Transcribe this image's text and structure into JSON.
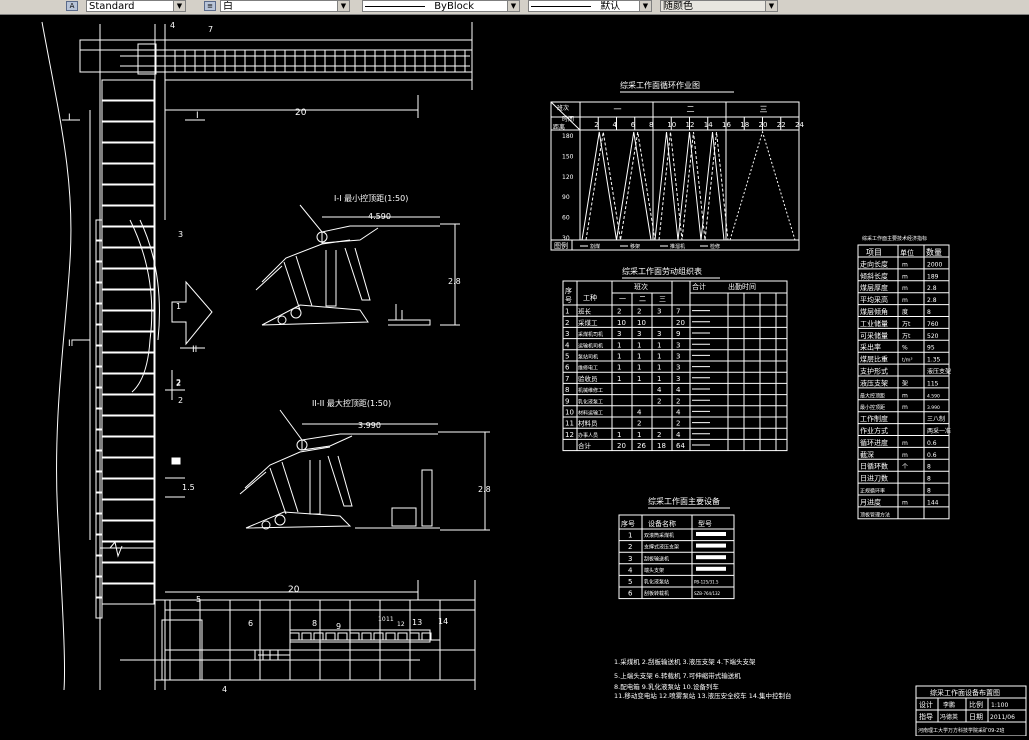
{
  "toolbar": {
    "text_style": "Standard",
    "layer": "白",
    "linetype": "ByBlock",
    "lineweight": "默认",
    "plot_style": "随颜色"
  },
  "drawing": {
    "dim_top_20": "20",
    "dim_bottom_20": "20",
    "section_I": "I",
    "section_II": "II",
    "callouts": [
      "1",
      "2",
      "3",
      "4",
      "5",
      "6",
      "7",
      "8",
      "9",
      "10",
      "11",
      "12",
      "13",
      "14"
    ],
    "dim_2": "2",
    "dim_1_5": "1.5",
    "dim_4": "4",
    "min_section_title": "I-I  最小控顶距(1:50)",
    "min_section_width": "4.590",
    "min_section_height": "2.8",
    "max_section_title": "II-II 最大控顶距(1:50)",
    "max_section_width": "3.990",
    "max_section_height": "2.8"
  },
  "cycle_chart": {
    "title": "综采工作面循环作业图",
    "corner_top": "班次",
    "corner_mid": "时间",
    "corner_bot": "距离",
    "shifts": [
      "一",
      "二",
      "三"
    ],
    "hours": [
      "2",
      "4",
      "6",
      "8",
      "10",
      "12",
      "14",
      "16",
      "18",
      "20",
      "22",
      "24"
    ],
    "distances": [
      "180",
      "150",
      "120",
      "90",
      "60",
      "30"
    ],
    "legend_label": "图例",
    "legend_items": [
      "割煤",
      "移架",
      "推溜机",
      "检修"
    ]
  },
  "labor_table": {
    "title": "综采工作面劳动组织表",
    "h_no": "序号",
    "h_type": "工种",
    "h_shift": "班次",
    "h_total": "合计",
    "h_time": "出勤时间",
    "shift_cols": [
      "一",
      "二",
      "三"
    ],
    "rows": [
      {
        "n": "1",
        "t": "班长",
        "a": "2",
        "b": "2",
        "c": "3",
        "s": "7"
      },
      {
        "n": "2",
        "t": "采煤工",
        "a": "10",
        "b": "10",
        "c": "",
        "s": "20"
      },
      {
        "n": "3",
        "t": "采煤机司机",
        "a": "3",
        "b": "3",
        "c": "3",
        "s": "9"
      },
      {
        "n": "4",
        "t": "运输机司机",
        "a": "1",
        "b": "1",
        "c": "1",
        "s": "3"
      },
      {
        "n": "5",
        "t": "泵站司机",
        "a": "1",
        "b": "1",
        "c": "1",
        "s": "3"
      },
      {
        "n": "6",
        "t": "维修电工",
        "a": "1",
        "b": "1",
        "c": "1",
        "s": "3"
      },
      {
        "n": "7",
        "t": "验收员",
        "a": "1",
        "b": "1",
        "c": "1",
        "s": "3"
      },
      {
        "n": "8",
        "t": "机械维修工",
        "a": "",
        "b": "",
        "c": "4",
        "s": "4"
      },
      {
        "n": "9",
        "t": "乳化液泵工",
        "a": "",
        "b": "",
        "c": "2",
        "s": "2"
      },
      {
        "n": "10",
        "t": "材料运输工",
        "a": "",
        "b": "4",
        "c": "",
        "s": "4"
      },
      {
        "n": "11",
        "t": "材料员",
        "a": "",
        "b": "2",
        "c": "",
        "s": "2"
      },
      {
        "n": "12",
        "t": "办事人员",
        "a": "1",
        "b": "1",
        "c": "2",
        "s": "4"
      },
      {
        "n": "",
        "t": "合计",
        "a": "20",
        "b": "26",
        "c": "18",
        "s": "64"
      }
    ]
  },
  "equipment_table": {
    "title": "综采工作面主要设备",
    "h_no": "序号",
    "h_name": "设备名称",
    "h_model": "型号",
    "rows": [
      {
        "n": "1",
        "name": "双滚筒采煤机",
        "model": ""
      },
      {
        "n": "2",
        "name": "支撑式液压支架",
        "model": ""
      },
      {
        "n": "3",
        "name": "刮板输送机",
        "model": ""
      },
      {
        "n": "4",
        "name": "端头支架",
        "model": ""
      },
      {
        "n": "5",
        "name": "乳化液泵站",
        "model": "PB-125/31.5"
      },
      {
        "n": "6",
        "name": "刮板转载机",
        "model": "SZB-764/132"
      }
    ]
  },
  "params_table": {
    "title": "综采工作面主要技术经济指标",
    "h_item": "项目",
    "h_unit": "单位",
    "h_qty": "数量",
    "rows": [
      {
        "i": "走向长度",
        "u": "m",
        "q": "2000"
      },
      {
        "i": "倾斜长度",
        "u": "m",
        "q": "189"
      },
      {
        "i": "煤层厚度",
        "u": "m",
        "q": "2.8"
      },
      {
        "i": "平均采高",
        "u": "m",
        "q": "2.8"
      },
      {
        "i": "煤层倾角",
        "u": "度",
        "q": "8"
      },
      {
        "i": "工业储量",
        "u": "万t",
        "q": "760"
      },
      {
        "i": "可采储量",
        "u": "万t",
        "q": "520"
      },
      {
        "i": "采出率",
        "u": "%",
        "q": "95"
      },
      {
        "i": "煤层比重",
        "u": "t/m³",
        "q": "1.35"
      },
      {
        "i": "支护形式",
        "u": "",
        "q": "液压支架"
      },
      {
        "i": "液压支架",
        "u": "架",
        "q": "115"
      },
      {
        "i": "最大控顶距",
        "u": "m",
        "q": "4.590"
      },
      {
        "i": "最小控顶距",
        "u": "m",
        "q": "3.990"
      },
      {
        "i": "工作制度",
        "u": "",
        "q": "三八制"
      },
      {
        "i": "作业方式",
        "u": "",
        "q": "两采一准"
      },
      {
        "i": "循环进度",
        "u": "m",
        "q": "0.6"
      },
      {
        "i": "截深",
        "u": "m",
        "q": "0.6"
      },
      {
        "i": "日循环数",
        "u": "个",
        "q": "8"
      },
      {
        "i": "日进刀数",
        "u": "",
        "q": "8"
      },
      {
        "i": "正规循环率",
        "u": "",
        "q": "8"
      },
      {
        "i": "月进度",
        "u": "m",
        "q": "144"
      },
      {
        "i": "顶板管理方法",
        "u": "",
        "q": ""
      }
    ]
  },
  "legend_notes": [
    "1.采煤机  2.刮板输送机  3.液压支架  4.下端头支架",
    "5.上端头支架  6.转载机  7.可伸缩带式输送机",
    "8.配电箱  9.乳化液泵站  10.设备列车",
    "11.移动变电站 12.喷雾泵站  13.液压安全绞车 14.集中控制台"
  ],
  "title_block": {
    "title": "综采工作面设备布置图",
    "design": "设计",
    "designer": "李鹏",
    "scale_label": "比例",
    "scale": "1:100",
    "guide": "指导",
    "guide_name": "冯德英",
    "date_label": "日期",
    "date": "2011/06",
    "org": "河南理工大学万方科技学院采矿09-2班"
  }
}
